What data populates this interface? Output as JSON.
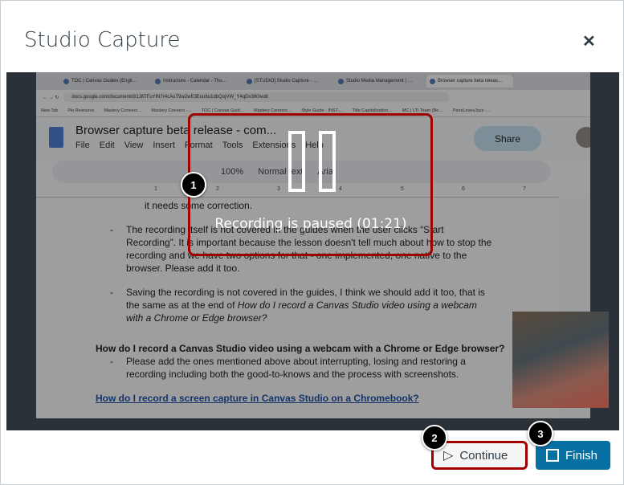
{
  "modal": {
    "title": "Studio Capture",
    "close_icon": "close-icon"
  },
  "browser": {
    "tabs": [
      "TOC | Canvas Guides (Engli…",
      "Instructure - Calendar - Thu…",
      "[STUDIO] Studio Capture - …",
      "Studio Media Management | …",
      "Browser capture beta releas…"
    ],
    "url": "docs.google.com/document/d/1J6TFuYlN7r4cAuT9w2wE3Euu6u1dbQojVW_Y4qDx360/edit",
    "bookmarks": [
      "New Tab",
      "Pin Resource",
      "Mastery Connect…",
      "Mastery Connect -…",
      "TOC | Canvas Guid…",
      "Mastery Connect…",
      "Style Guide - INST…",
      "Title Capitalization…",
      "MC | LTI Team (Bo…",
      "ParisLovesJazz -…"
    ]
  },
  "doc": {
    "title": "Browser capture beta release - com...",
    "menu": [
      "File",
      "Edit",
      "View",
      "Insert",
      "Format",
      "Tools",
      "Extensions",
      "Help"
    ],
    "share": "Share",
    "zoom": "100%",
    "style": "Normal text",
    "font": "Arial",
    "ruler": [
      "1",
      "2",
      "3",
      "4",
      "5",
      "6",
      "7"
    ],
    "line0": "it needs some correction.",
    "bullet1": "The recording itself is not covered in the guides when the user clicks “Start Recording”. It is important because the lesson doesn't tell much about how to stop the recording and we have two options for that - one implemented, one native to the browser. Please add it too.",
    "bullet2a": "Saving the recording is not covered in the guides, I think we should add it too, that is the same as at the end of ",
    "bullet2b": "How do I record a Canvas Studio video using a webcam with a Chrome or Edge browser?",
    "heading": "How do I record a Canvas Studio video using a webcam with a Chrome or Edge browser?",
    "bullet3": "Please add the ones mentioned above about interrupting, losing and restoring a recording including both the good-to-knows and the process with screenshots.",
    "link": "How do I record a screen capture in Canvas Studio on a Chromebook?"
  },
  "overlay": {
    "status": "Recording is paused (01:21)",
    "badges": [
      "1",
      "2",
      "3"
    ]
  },
  "actions": {
    "continue": "Continue",
    "finish": "Finish"
  },
  "colors": {
    "accent": "#0770a3",
    "highlight": "#a00000"
  }
}
